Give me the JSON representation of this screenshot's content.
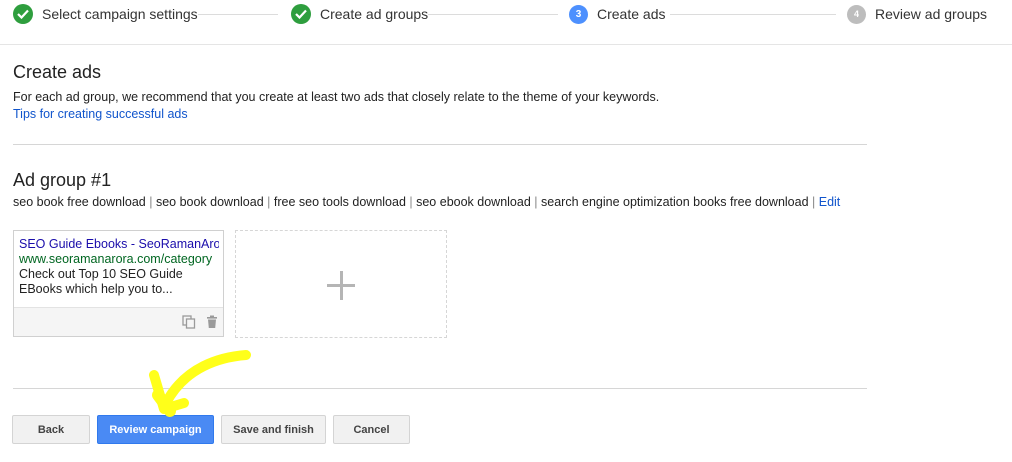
{
  "stepper": {
    "steps": [
      {
        "label": "Select campaign settings",
        "state": "done",
        "marker": ""
      },
      {
        "label": "Create ad groups",
        "state": "done",
        "marker": ""
      },
      {
        "label": "Create ads",
        "state": "current",
        "marker": "3"
      },
      {
        "label": "Review ad groups",
        "state": "todo",
        "marker": "4"
      }
    ]
  },
  "page": {
    "title": "Create ads",
    "description": "For each ad group, we recommend that you create at least two ads that closely relate to the theme of your keywords.",
    "tips_link": "Tips for creating successful ads"
  },
  "ad_group": {
    "title": "Ad group #1",
    "keywords": [
      "seo book free download",
      "seo book download",
      "free seo tools download",
      "seo ebook download",
      "search engine optimization books free download"
    ],
    "separator": " | ",
    "edit_label": "Edit",
    "ad": {
      "headline": "SEO Guide Ebooks - SeoRamanArora",
      "display_url": "www.seoramanarora.com/category",
      "text": "Check out Top 10 SEO Guide EBooks which help you to..."
    }
  },
  "buttons": {
    "back": "Back",
    "review": "Review campaign",
    "save": "Save and finish",
    "cancel": "Cancel"
  },
  "colors": {
    "done": "#2e9e3e",
    "current": "#4d90fe",
    "todo": "#bdbdbd",
    "link": "#1155cc",
    "primary_button": "#4a8af4",
    "annotation": "#ffff1a"
  },
  "icons": {
    "done_step": "check-icon",
    "copy": "copy-icon",
    "delete": "trash-icon",
    "add_ad": "plus-icon"
  }
}
